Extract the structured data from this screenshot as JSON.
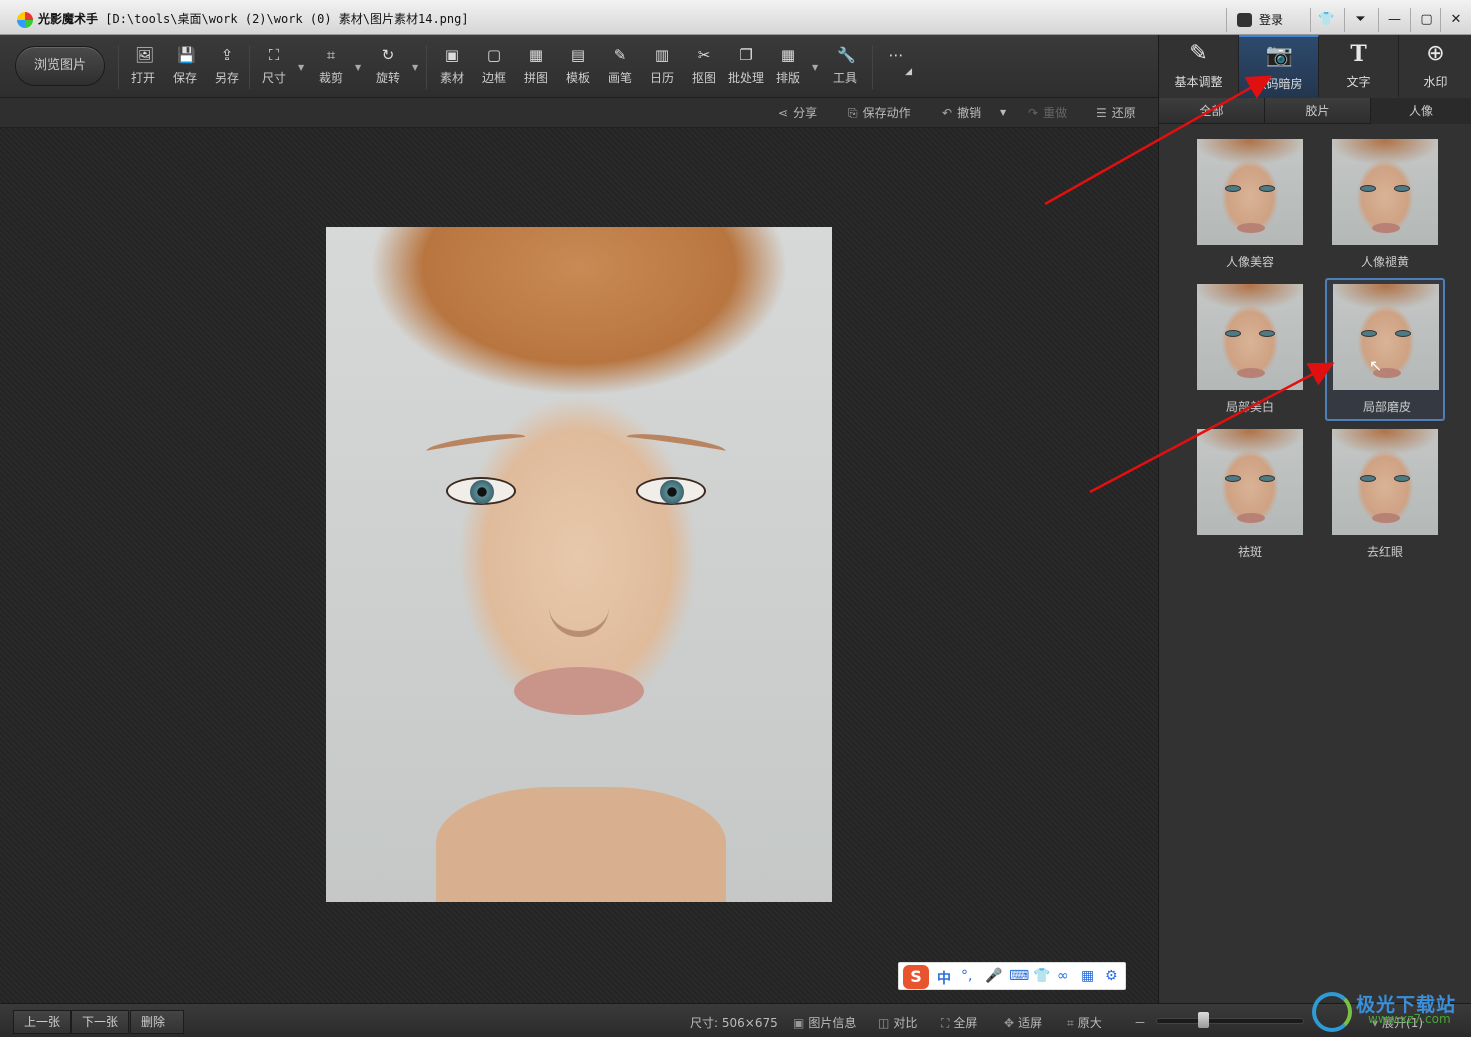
{
  "window": {
    "app_name": "光影魔术手",
    "file_path": "[D:\\tools\\桌面\\work (2)\\work (0) 素材\\图片素材14.png]",
    "login_label": "登录",
    "buttons": {
      "skin": "👕",
      "menu": "⏷",
      "minimize": "—",
      "maximize": "▢",
      "close": "✕"
    }
  },
  "toolbar": {
    "browse_label": "浏览图片",
    "tools": [
      {
        "label": "打开",
        "icon": "open-icon",
        "glyph": "🖼"
      },
      {
        "label": "保存",
        "icon": "save-icon",
        "glyph": "💾"
      },
      {
        "label": "另存",
        "icon": "save-as-icon",
        "glyph": "⇪"
      },
      {
        "label": "尺寸",
        "icon": "resize-icon",
        "glyph": "⛶"
      },
      {
        "label": "裁剪",
        "icon": "crop-icon",
        "glyph": "⌗"
      },
      {
        "label": "旋转",
        "icon": "rotate-icon",
        "glyph": "↻"
      },
      {
        "label": "素材",
        "icon": "material-icon",
        "glyph": "▣"
      },
      {
        "label": "边框",
        "icon": "border-icon",
        "glyph": "▢"
      },
      {
        "label": "拼图",
        "icon": "collage-icon",
        "glyph": "▦"
      },
      {
        "label": "模板",
        "icon": "template-icon",
        "glyph": "▤"
      },
      {
        "label": "画笔",
        "icon": "brush-icon",
        "glyph": "✎"
      },
      {
        "label": "日历",
        "icon": "calendar-icon",
        "glyph": "▥"
      },
      {
        "label": "抠图",
        "icon": "cutout-icon",
        "glyph": "✂"
      },
      {
        "label": "批处理",
        "icon": "batch-icon",
        "glyph": "❐"
      },
      {
        "label": "排版",
        "icon": "layout-icon",
        "glyph": "▦"
      },
      {
        "label": "工具",
        "icon": "wrench-icon",
        "glyph": "🔧"
      }
    ],
    "more_glyph": "⋯"
  },
  "subbar": {
    "share": "分享",
    "save_action": "保存动作",
    "undo": "撤销",
    "redo": "重做",
    "restore": "还原"
  },
  "right_panel": {
    "tabs": [
      {
        "label": "基本调整",
        "icon": "basic-adjust-icon",
        "glyph": "✎"
      },
      {
        "label": "数码暗房",
        "icon": "darkroom-icon",
        "glyph": "📷"
      },
      {
        "label": "文字",
        "icon": "text-icon",
        "glyph": "T"
      },
      {
        "label": "水印",
        "icon": "watermark-icon",
        "glyph": "⊕"
      }
    ],
    "active_tab": "数码暗房",
    "categories": [
      "全部",
      "胶片",
      "人像"
    ],
    "active_category": "人像",
    "effects": [
      "人像美容",
      "人像褪黄",
      "局部美白",
      "局部磨皮",
      "祛斑",
      "去红眼"
    ],
    "selected_effect": "局部磨皮"
  },
  "ime": {
    "logo": "S",
    "lang": "中",
    "glyphs": [
      "°,",
      "🎤",
      "⌨",
      "👕",
      "∞",
      "▦",
      "⚙"
    ]
  },
  "status_bar": {
    "prev": "上一张",
    "next": "下一张",
    "delete": "删除",
    "size_label": "尺寸: 506×675",
    "info": "图片信息",
    "compare": "对比",
    "fullscreen": "全屏",
    "fit": "适屏",
    "original": "原大",
    "zoom_minus": "－",
    "expand": "展开(1)"
  },
  "watermark": {
    "text": "极光下载站",
    "url": "www.xz7.com"
  },
  "colors": {
    "accent": "#3d83d6",
    "arrow": "#e01010",
    "panel": "#323232",
    "canvas": "#262626"
  }
}
